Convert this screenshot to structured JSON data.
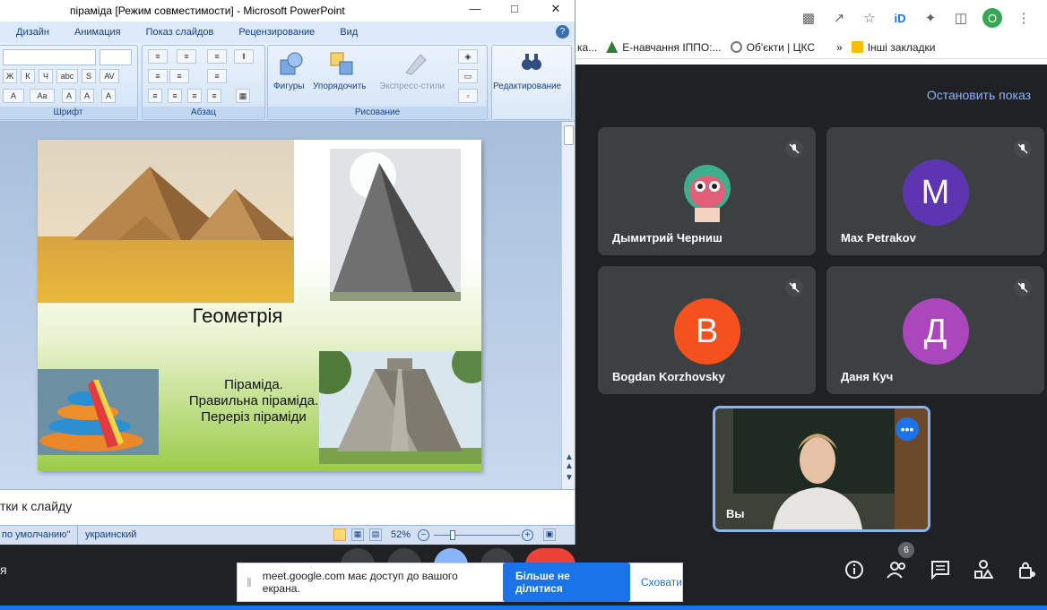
{
  "ppt": {
    "title": "піраміда [Режим совместимости] - Microsoft PowerPoint",
    "tabs": [
      "Дизайн",
      "Анимация",
      "Показ слайдов",
      "Рецензирование",
      "Вид"
    ],
    "groups": {
      "font": "Шрифт",
      "paragraph": "Абзац",
      "drawing": "Рисование"
    },
    "buttons": {
      "shapes": "Фигуры",
      "arrange": "Упорядочить",
      "quick_styles": "Экспресс-стили",
      "editing": "Редактирование"
    },
    "slide": {
      "title": "Геометрія",
      "subtitle": "Піраміда. Правильна піраміда. Переріз піраміди"
    },
    "notes": "тки к слайду",
    "status": {
      "theme": "по умолчанию\"",
      "language": "украинский",
      "zoom": "52%"
    }
  },
  "chrome": {
    "bookmarks": [
      "ка...",
      "Е-навчання ІППО:...",
      "Об'єкти | ЦКС",
      "»",
      "Інші закладки"
    ],
    "profile_initial": "О"
  },
  "meet": {
    "stop_presenting": "Остановить показ",
    "participants": [
      {
        "name": "Дымитрий Черниш",
        "initial": "",
        "color": "#3c4043"
      },
      {
        "name": "Max Petrakov",
        "initial": "M",
        "color": "#5e35b1"
      },
      {
        "name": "Bogdan Korzhovsky",
        "initial": "B",
        "color": "#f4511e"
      },
      {
        "name": "Даня Куч",
        "initial": "Д",
        "color": "#ab47bc"
      }
    ],
    "self_name": "Вы",
    "people_count": "6",
    "bottom_left_text": "я"
  },
  "share_bar": {
    "text": "meet.google.com має доступ до вашого екрана.",
    "stop_button": "Більше не ділитися",
    "hide_button": "Сховати"
  }
}
